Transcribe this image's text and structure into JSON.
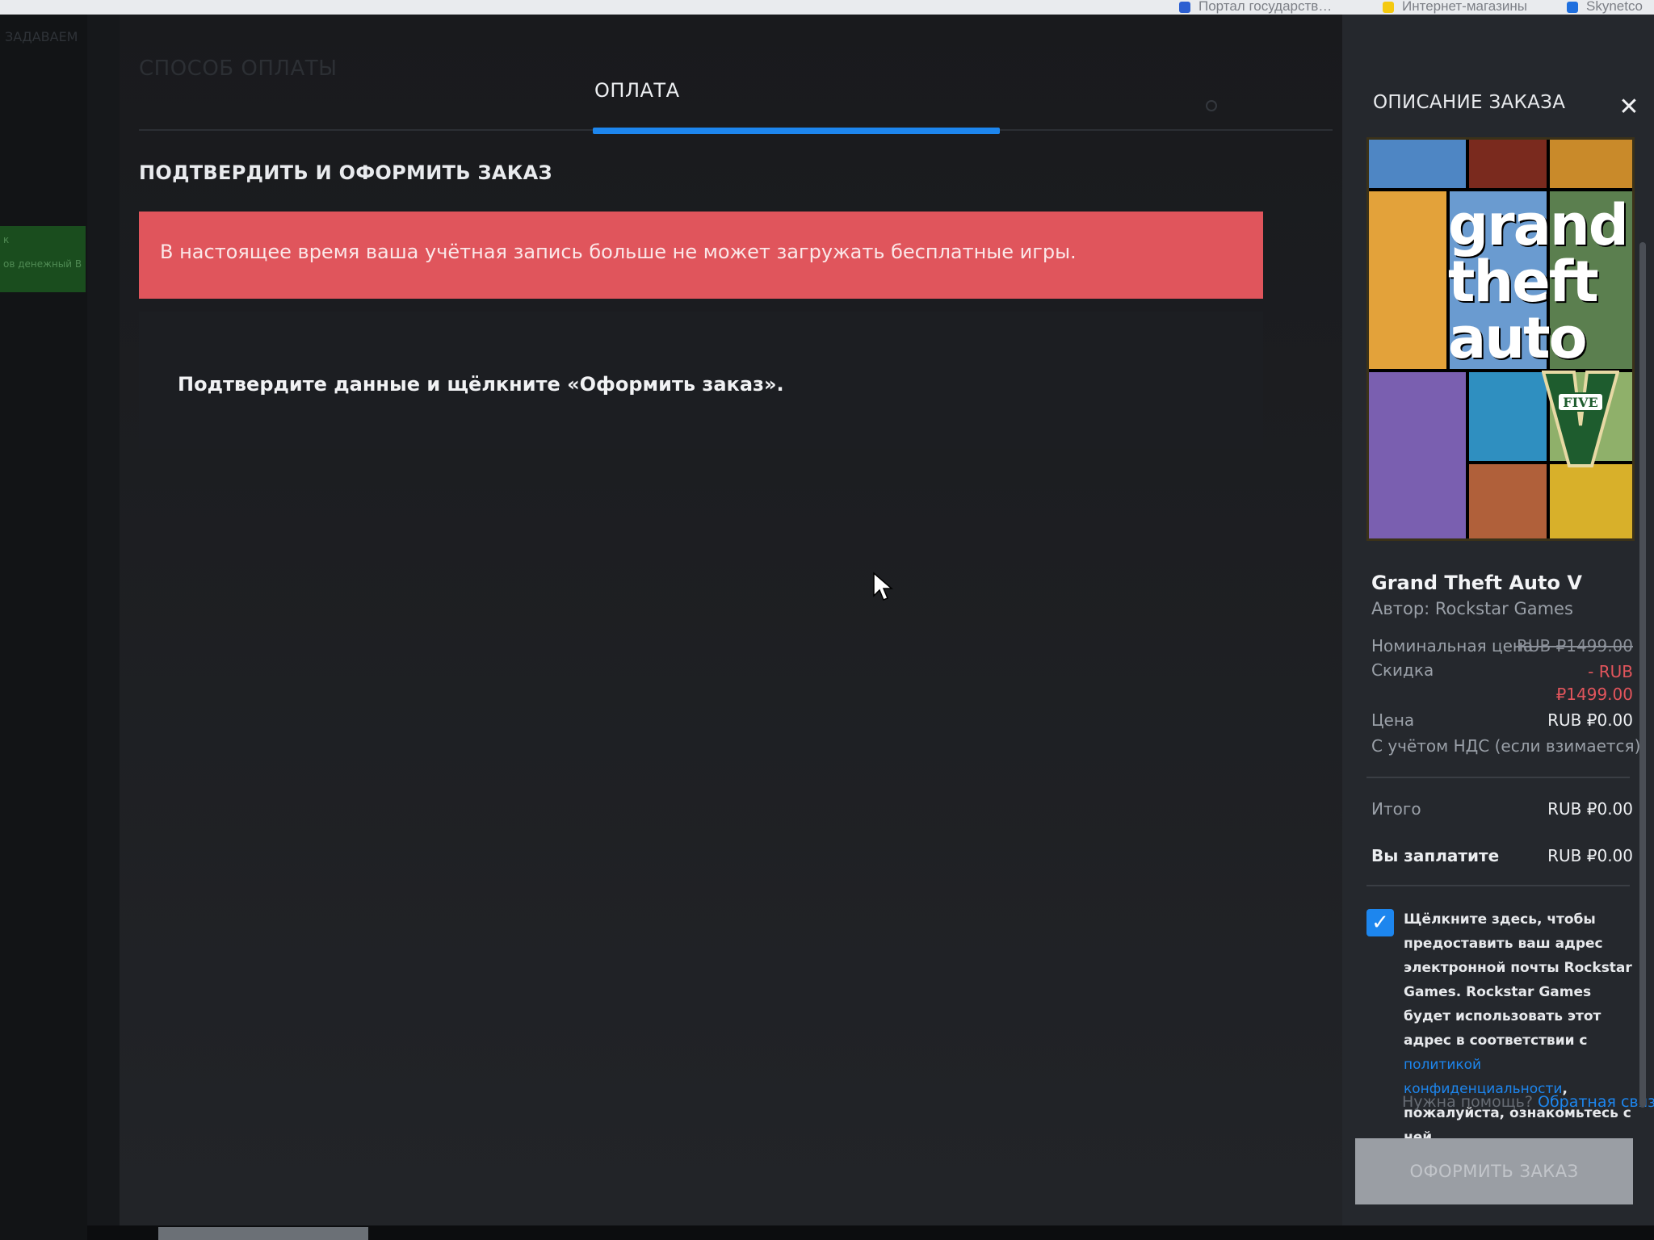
{
  "browser": {
    "bookmarks": [
      {
        "label": "Портал государств…",
        "color": "#2c5fd1"
      },
      {
        "label": "Интернет-магазины",
        "color": "#f4c90f"
      },
      {
        "label": "Skynetco",
        "color": "#1f6fde"
      }
    ]
  },
  "background_app": {
    "top_label": "ЗАДАВАЕМ",
    "green_label_1": "к",
    "green_label_2": "ов денежный В"
  },
  "checkout": {
    "steps": {
      "previous": "СПОСОБ ОПЛАТЫ",
      "current": "ОПЛАТА"
    },
    "heading": "ПОДТВЕРДИТЬ И ОФОРМИТЬ ЗАКАЗ",
    "alert": "В настоящее время ваша учётная запись больше не может загружать бесплатные игры.",
    "confirm_prompt": "Подтвердите данные и щёлкните «Оформить заказ»."
  },
  "order": {
    "title": "ОПИСАНИЕ ЗАКАЗА",
    "close_icon": "close-icon",
    "game": {
      "cover_logo_lines": [
        "grand",
        "theft",
        "auto"
      ],
      "cover_logo_badge": "FIVE",
      "name": "Grand Theft Auto V",
      "author": "Автор: Rockstar Games"
    },
    "pricing": {
      "nominal_label": "Номинальная цена",
      "nominal_value": "RUB ₽1499.00",
      "discount_label": "Скидка",
      "discount_value_1": "- RUB",
      "discount_value_2": "₽1499.00",
      "price_label": "Цена",
      "price_value": "RUB ₽0.00",
      "vat_note": "С учётом НДС (если взимается)",
      "total_label": "Итого",
      "total_value": "RUB ₽0.00",
      "pay_label": "Вы заплатите",
      "pay_value": "RUB ₽0.00"
    },
    "consent": {
      "checked": true,
      "text_before": "Щёлкните здесь, чтобы предоставить ваш адрес электронной почты Rockstar Games. Rockstar Games будет использовать этот адрес в соответствии с ",
      "link": "политикой конфиденциальности",
      "text_after": ", пожалуйста, ознакомьтесь с ней."
    },
    "help_text": "Нужна помощь?",
    "help_link": "Обратная связь",
    "button": "ОФОРМИТЬ ЗАКАЗ"
  },
  "colors": {
    "accent": "#1d86ee",
    "alert": "#e0555c",
    "panel": "#25282d"
  }
}
